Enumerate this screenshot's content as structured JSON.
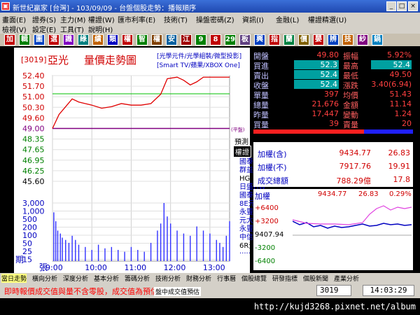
{
  "window": {
    "title": "新世紀贏家 [台灣] - 103/09/09 - 台盤個股走勢：播報順序",
    "app_icon": "app-icon",
    "controls": [
      "_",
      "□",
      "×"
    ]
  },
  "menu": {
    "row1": [
      "畫面(E)",
      "證券(S)",
      "主力(M)",
      "權證(W)",
      "匯市利率(E)",
      "技術(T)",
      "操盤密碼(Z)",
      "資訊(I)",
      "金融(L)",
      "權證精選(U)"
    ],
    "row2": [
      "檢視(V)",
      "設定(E)",
      "工具(T)",
      "說明(H)"
    ]
  },
  "toolbar": {
    "items": [
      "加",
      "輯",
      "圖",
      "選",
      "識",
      "綠",
      "績",
      "類",
      "權",
      "智",
      "權",
      "安",
      "江",
      "9",
      "8",
      "29",
      "板",
      "興",
      "指",
      "蘭",
      "價",
      "嬰",
      "辨",
      "技",
      "紗",
      "鍋"
    ]
  },
  "stock": {
    "code": "3019",
    "name": "亞光",
    "chart_title": "量價走勢圖",
    "tags1": "[光學元件/光學組裝/微型投影]",
    "tags2": "[Smart TV/蘋果/XBOX One]"
  },
  "chart_data": {
    "type": "line",
    "price_ticks": [
      "52.40",
      "51.70",
      "51.00",
      "50.30",
      "49.60",
      "49.00",
      "48.35",
      "47.65",
      "46.95",
      "46.25",
      "45.60"
    ],
    "volume_ticks": [
      "3,000",
      "1,000",
      "500",
      "200",
      "100",
      "50",
      "25",
      "15"
    ],
    "time_ticks": [
      "9:00",
      "10:00",
      "11:00",
      "12:00",
      "13:00"
    ],
    "ref_label": "(平盤)",
    "y_axis_label": "張",
    "x_axis_label": "期",
    "ylim": [
      45.6,
      52.4
    ],
    "price": [
      [
        0,
        49.0
      ],
      [
        10,
        49.9
      ],
      [
        20,
        50.4
      ],
      [
        30,
        50.9
      ],
      [
        40,
        50.7
      ],
      [
        50,
        50.6
      ],
      [
        60,
        50.5
      ],
      [
        75,
        50.3
      ],
      [
        90,
        50.4
      ],
      [
        105,
        50.6
      ],
      [
        120,
        50.5
      ],
      [
        135,
        50.5
      ],
      [
        150,
        50.6
      ],
      [
        165,
        51.2
      ],
      [
        175,
        52.2
      ],
      [
        190,
        52.3
      ],
      [
        200,
        52.1
      ],
      [
        210,
        51.8
      ],
      [
        220,
        52.0
      ],
      [
        230,
        52.3
      ],
      [
        240,
        52.3
      ],
      [
        255,
        52.3
      ],
      [
        270,
        52.3
      ]
    ],
    "volume": [
      [
        2,
        1200
      ],
      [
        5,
        500
      ],
      [
        8,
        200
      ],
      [
        12,
        150
      ],
      [
        15,
        100
      ],
      [
        20,
        80
      ],
      [
        25,
        60
      ],
      [
        30,
        120
      ],
      [
        35,
        80
      ],
      [
        40,
        50
      ],
      [
        50,
        40
      ],
      [
        60,
        30
      ],
      [
        70,
        50
      ],
      [
        80,
        35
      ],
      [
        90,
        40
      ],
      [
        100,
        30
      ],
      [
        110,
        25
      ],
      [
        120,
        40
      ],
      [
        130,
        30
      ],
      [
        140,
        25
      ],
      [
        150,
        60
      ],
      [
        160,
        200
      ],
      [
        165,
        400
      ],
      [
        170,
        3000
      ],
      [
        175,
        800
      ],
      [
        180,
        400
      ],
      [
        190,
        200
      ],
      [
        200,
        150
      ],
      [
        210,
        120
      ],
      [
        220,
        300
      ],
      [
        230,
        200
      ],
      [
        240,
        150
      ],
      [
        250,
        80
      ],
      [
        255,
        60
      ],
      [
        260,
        40
      ],
      [
        265,
        120
      ],
      [
        270,
        500
      ]
    ]
  },
  "quote": {
    "rows": [
      {
        "l": "開盤",
        "v": "49.80",
        "l2": "振幅",
        "v2": "5.92%"
      },
      {
        "l": "買進",
        "v": "52.3",
        "l2": "最高",
        "v2": "52.4"
      },
      {
        "l": "賣出",
        "v": "52.4",
        "l2": "最低",
        "v2": "49.50"
      },
      {
        "l": "收盤",
        "v": "52.4",
        "l2": "漲跌",
        "v2": "3.40(6.94)"
      },
      {
        "l": "單量",
        "v": "397",
        "l2": "均價",
        "v2": "51.43"
      },
      {
        "l": "總量",
        "v": "21,676",
        "l2": "金額",
        "v2": "11.14"
      },
      {
        "l": "昨量",
        "v": "17,447",
        "l2": "變動",
        "v2": "1.24"
      },
      {
        "l": "買量",
        "v": "39",
        "l2": "賣量",
        "v2": "20"
      }
    ],
    "predict": "預測",
    "rights": "權證",
    "brokers": [
      "國泰7K",
      "群益MD",
      "HG凱基",
      "日盛HW",
      "國泰4U",
      "8E元富",
      "永豐BZ",
      "元大FG",
      "永豐BS",
      "中信88",
      "6R元富",
      "....."
    ]
  },
  "index": {
    "rows": [
      {
        "l": "加權(含)",
        "v": "9434.77",
        "v2": "26.83"
      },
      {
        "l": "加權(不)",
        "v": "7917.76",
        "v2": "19.91"
      },
      {
        "l": "成交總額",
        "v": "788.29億",
        "v2": "17.8"
      }
    ],
    "mini_title": "加權",
    "mini_value": "9434.77",
    "mini_change": "26.83",
    "mini_pct": "0.29%",
    "mini_ticks": [
      "+6400",
      "+3200",
      "9407.94",
      "-3200",
      "-6400"
    ]
  },
  "tabs": [
    "當日走勢",
    "橫向分析",
    "深度分析",
    "基本分析",
    "籌碼分析",
    "技術分析",
    "財務分析",
    "行事曆",
    "個股總覽",
    "研發指標",
    "個股新聞",
    "產業分析"
  ],
  "status": {
    "ticker": "即時報價成交值與量不含零股，成交值為預估值)",
    "marquee": "盤中成交值預估",
    "code": "3019",
    "time": "14:03:29"
  },
  "watermark": "http://kujd3268.pixnet.net/album"
}
